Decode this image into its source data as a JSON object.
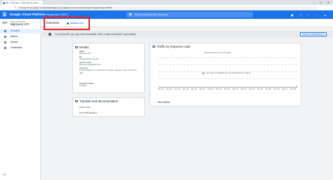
{
  "browser": {
    "tab_title": "BQ - Overview – APIs and services – ...",
    "window_controls": "– ☐ ✕",
    "nav_buttons": "← → ⟳",
    "url": "console.cloud.google.com/apis/api/bigquery.googleapis.com/overview?project=integral-data-223519"
  },
  "header": {
    "app_title": "Google Cloud Platform",
    "project": "⁞ integral-data-223519 ▾",
    "search_placeholder": "Search products and resources",
    "icons": "▣ ? ! ⋮ ●"
  },
  "sidebar": {
    "badge": "API",
    "group": "APIs & Services",
    "api_name": "BigQuery API",
    "items": [
      {
        "label": "Overview",
        "icon": "grid-icon",
        "active": true
      },
      {
        "label": "Metrics",
        "icon": "bar-chart-icon",
        "active": false
      },
      {
        "label": "Quotas",
        "icon": "gauge-icon",
        "active": false
      },
      {
        "label": "Credentials",
        "icon": "key-icon",
        "active": false
      }
    ],
    "collapse_glyph": "◁|"
  },
  "page": {
    "title": "Overview",
    "disable_label": "DISABLE API"
  },
  "banner": {
    "text": "To use this API, you may need credentials. Click 'Create credentials' to get started.",
    "button": "CREATE CREDENTIALS"
  },
  "details": {
    "title": "Details",
    "fields": [
      {
        "label": "Name",
        "value": "BigQuery API"
      },
      {
        "label": "By",
        "value": "Google Enterprise API"
      },
      {
        "label": "Service name",
        "value": "bigquery.googleapis.com"
      },
      {
        "label": "Overview",
        "value": "A data platform for customers to create, manage, share and query data."
      },
      {
        "label": "Activation status",
        "value": "Enabled"
      }
    ]
  },
  "tutorials": {
    "title": "Tutorials and documentation",
    "links": [
      "Learn more",
      "Try in API Explorer"
    ]
  },
  "traffic": {
    "title": "Traffic by response code",
    "subtitle": "Requests/sec (1 hr average)",
    "no_data": "No data is available for the selected time frame.",
    "view_metrics": "View metrics",
    "x_ticks": [
      "Nov 12",
      "Nov 13",
      "Nov 14",
      "Nov 15",
      "Nov 16",
      "Nov 17",
      "Nov 18",
      "Nov 19",
      "Nov 20",
      "Nov 21",
      "Nov 22",
      "Nov 23",
      "Nov 24",
      "Nov 25",
      "Nov 26",
      "Nov 27",
      "Nov 28"
    ],
    "y_zero": "0"
  },
  "colors": {
    "header_blue": "#1a73e8",
    "highlight_red": "#e8202a",
    "active_nav": "#e8f0fe"
  }
}
